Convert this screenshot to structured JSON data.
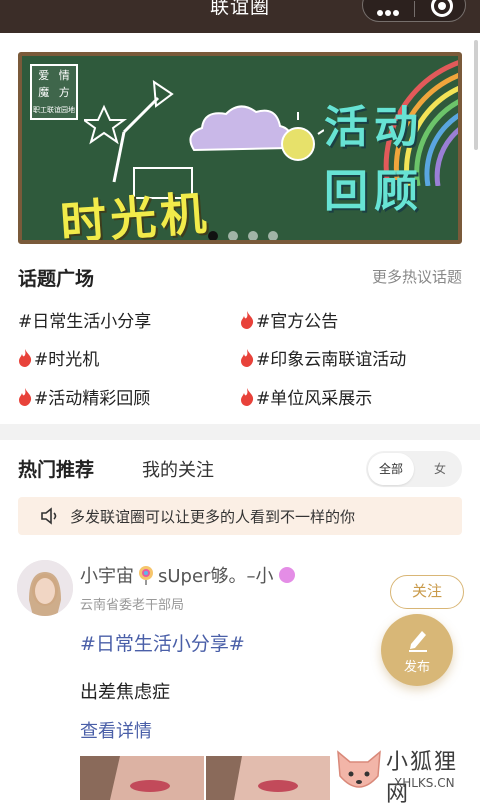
{
  "header": {
    "title": "联谊圈"
  },
  "banner": {
    "logo_chars": [
      "爱",
      "情",
      "魔",
      "方"
    ],
    "logo_sub": "职工联谊园地",
    "title_left": "时光机",
    "title_right_line1": "活动",
    "title_right_line2": "回顾",
    "active_dot": 1,
    "dot_count": 4
  },
  "topics": {
    "title": "话题广场",
    "more": "更多热议话题",
    "items": [
      {
        "label": "#日常生活小分享",
        "hot": false
      },
      {
        "label": "#官方公告",
        "hot": true
      },
      {
        "label": "#时光机",
        "hot": true
      },
      {
        "label": "#印象云南联谊活动",
        "hot": true
      },
      {
        "label": "#活动精彩回顾",
        "hot": true
      },
      {
        "label": "#单位风采展示",
        "hot": true
      }
    ]
  },
  "tabs": {
    "hot": "热门推荐",
    "follow": "我的关注",
    "filter_all": "全部",
    "filter_female": "女"
  },
  "notice": {
    "text": "多发联谊圈可以让更多的人看到不一样的你"
  },
  "post": {
    "username_a": "小宇宙",
    "username_b": "sUper够。–小",
    "org": "云南省委老干部局",
    "follow": "关注",
    "topic": "#日常生活小分享#",
    "text": "出差焦虑症",
    "more": "查看详情"
  },
  "fab": {
    "label": "发布"
  },
  "watermark": {
    "cn": "小狐狸网",
    "en": "XHLKS.CN"
  },
  "colors": {
    "header_bg": "#3b2d28",
    "accent_gold": "#d8b777",
    "link_blue": "#4a5fa8",
    "notice_bg": "#fbefe5",
    "flame_red": "#e8423a"
  }
}
